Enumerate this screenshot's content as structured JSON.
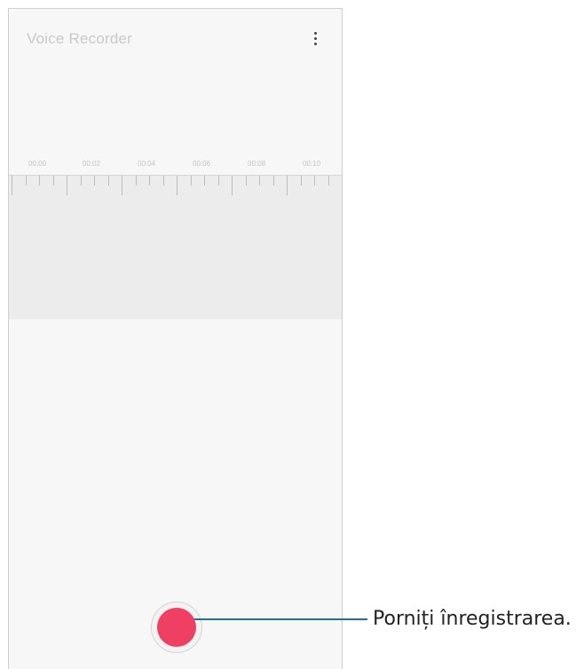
{
  "app": {
    "title": "Voice Recorder"
  },
  "menu": {
    "icon": "more-vert-icon"
  },
  "timeline": {
    "labels": [
      "00:00",
      "00:02",
      "00:04",
      "00:06",
      "00:08",
      "00:10"
    ]
  },
  "record": {
    "icon": "record-icon",
    "color": "#ef3f63"
  },
  "callout": {
    "text": "Porniți înregistrarea.",
    "line_color": "#1f6fa6"
  }
}
